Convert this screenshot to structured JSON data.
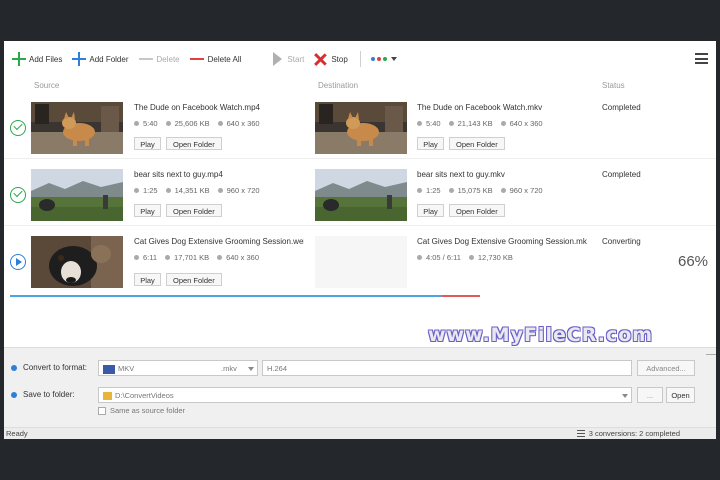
{
  "toolbar": {
    "add_files": "Add Files",
    "add_folder": "Add Folder",
    "delete": "Delete",
    "delete_all": "Delete All",
    "start": "Start",
    "stop": "Stop",
    "dot_colors": [
      "#2f7fd6",
      "#e04040",
      "#2aa84a"
    ]
  },
  "columns": {
    "source": "Source",
    "destination": "Destination",
    "status": "Status"
  },
  "rows": [
    {
      "state": "completed",
      "source": {
        "name": "The Dude on Facebook Watch.mp4",
        "duration": "5:40",
        "size": "25,606 KB",
        "resolution": "640 x 360"
      },
      "destination": {
        "name": "The Dude on Facebook Watch.mkv",
        "duration": "5:40",
        "size": "21,143 KB",
        "resolution": "640 x 360"
      },
      "status": "Completed",
      "play_label": "Play",
      "open_folder_label": "Open Folder"
    },
    {
      "state": "completed",
      "source": {
        "name": "bear sits next to guy.mp4",
        "duration": "1:25",
        "size": "14,351 KB",
        "resolution": "960 x 720"
      },
      "destination": {
        "name": "bear sits next to guy.mkv",
        "duration": "1:25",
        "size": "15,075 KB",
        "resolution": "960 x 720"
      },
      "status": "Completed",
      "play_label": "Play",
      "open_folder_label": "Open Folder"
    },
    {
      "state": "converting",
      "source": {
        "name": "Cat Gives Dog Extensive Grooming Session.webm",
        "duration": "6:11",
        "size": "17,701 KB",
        "resolution": "640 x 360"
      },
      "destination": {
        "name": "Cat Gives Dog Extensive Grooming Session.mkv",
        "duration": "4:05 / 6:11",
        "size": "12,730 KB"
      },
      "status": "Converting",
      "percent": "66%",
      "progress": 0.66,
      "play_label": "Play",
      "open_folder_label": "Open Folder"
    }
  ],
  "watermark": "www.MyFileCR.com",
  "convert": {
    "label": "Convert to format:",
    "format_value": "MKV",
    "format_ext": ".mkv",
    "codec_value": "H.264",
    "advanced_label": "Advanced..."
  },
  "save": {
    "label": "Save to folder:",
    "folder_value": "D:\\ConvertVideos",
    "browse_label": "...",
    "open_label": "Open",
    "same_as_source_label": "Same as source folder"
  },
  "statusbar": {
    "left": "Ready",
    "right": "3 conversions: 2 completed"
  }
}
